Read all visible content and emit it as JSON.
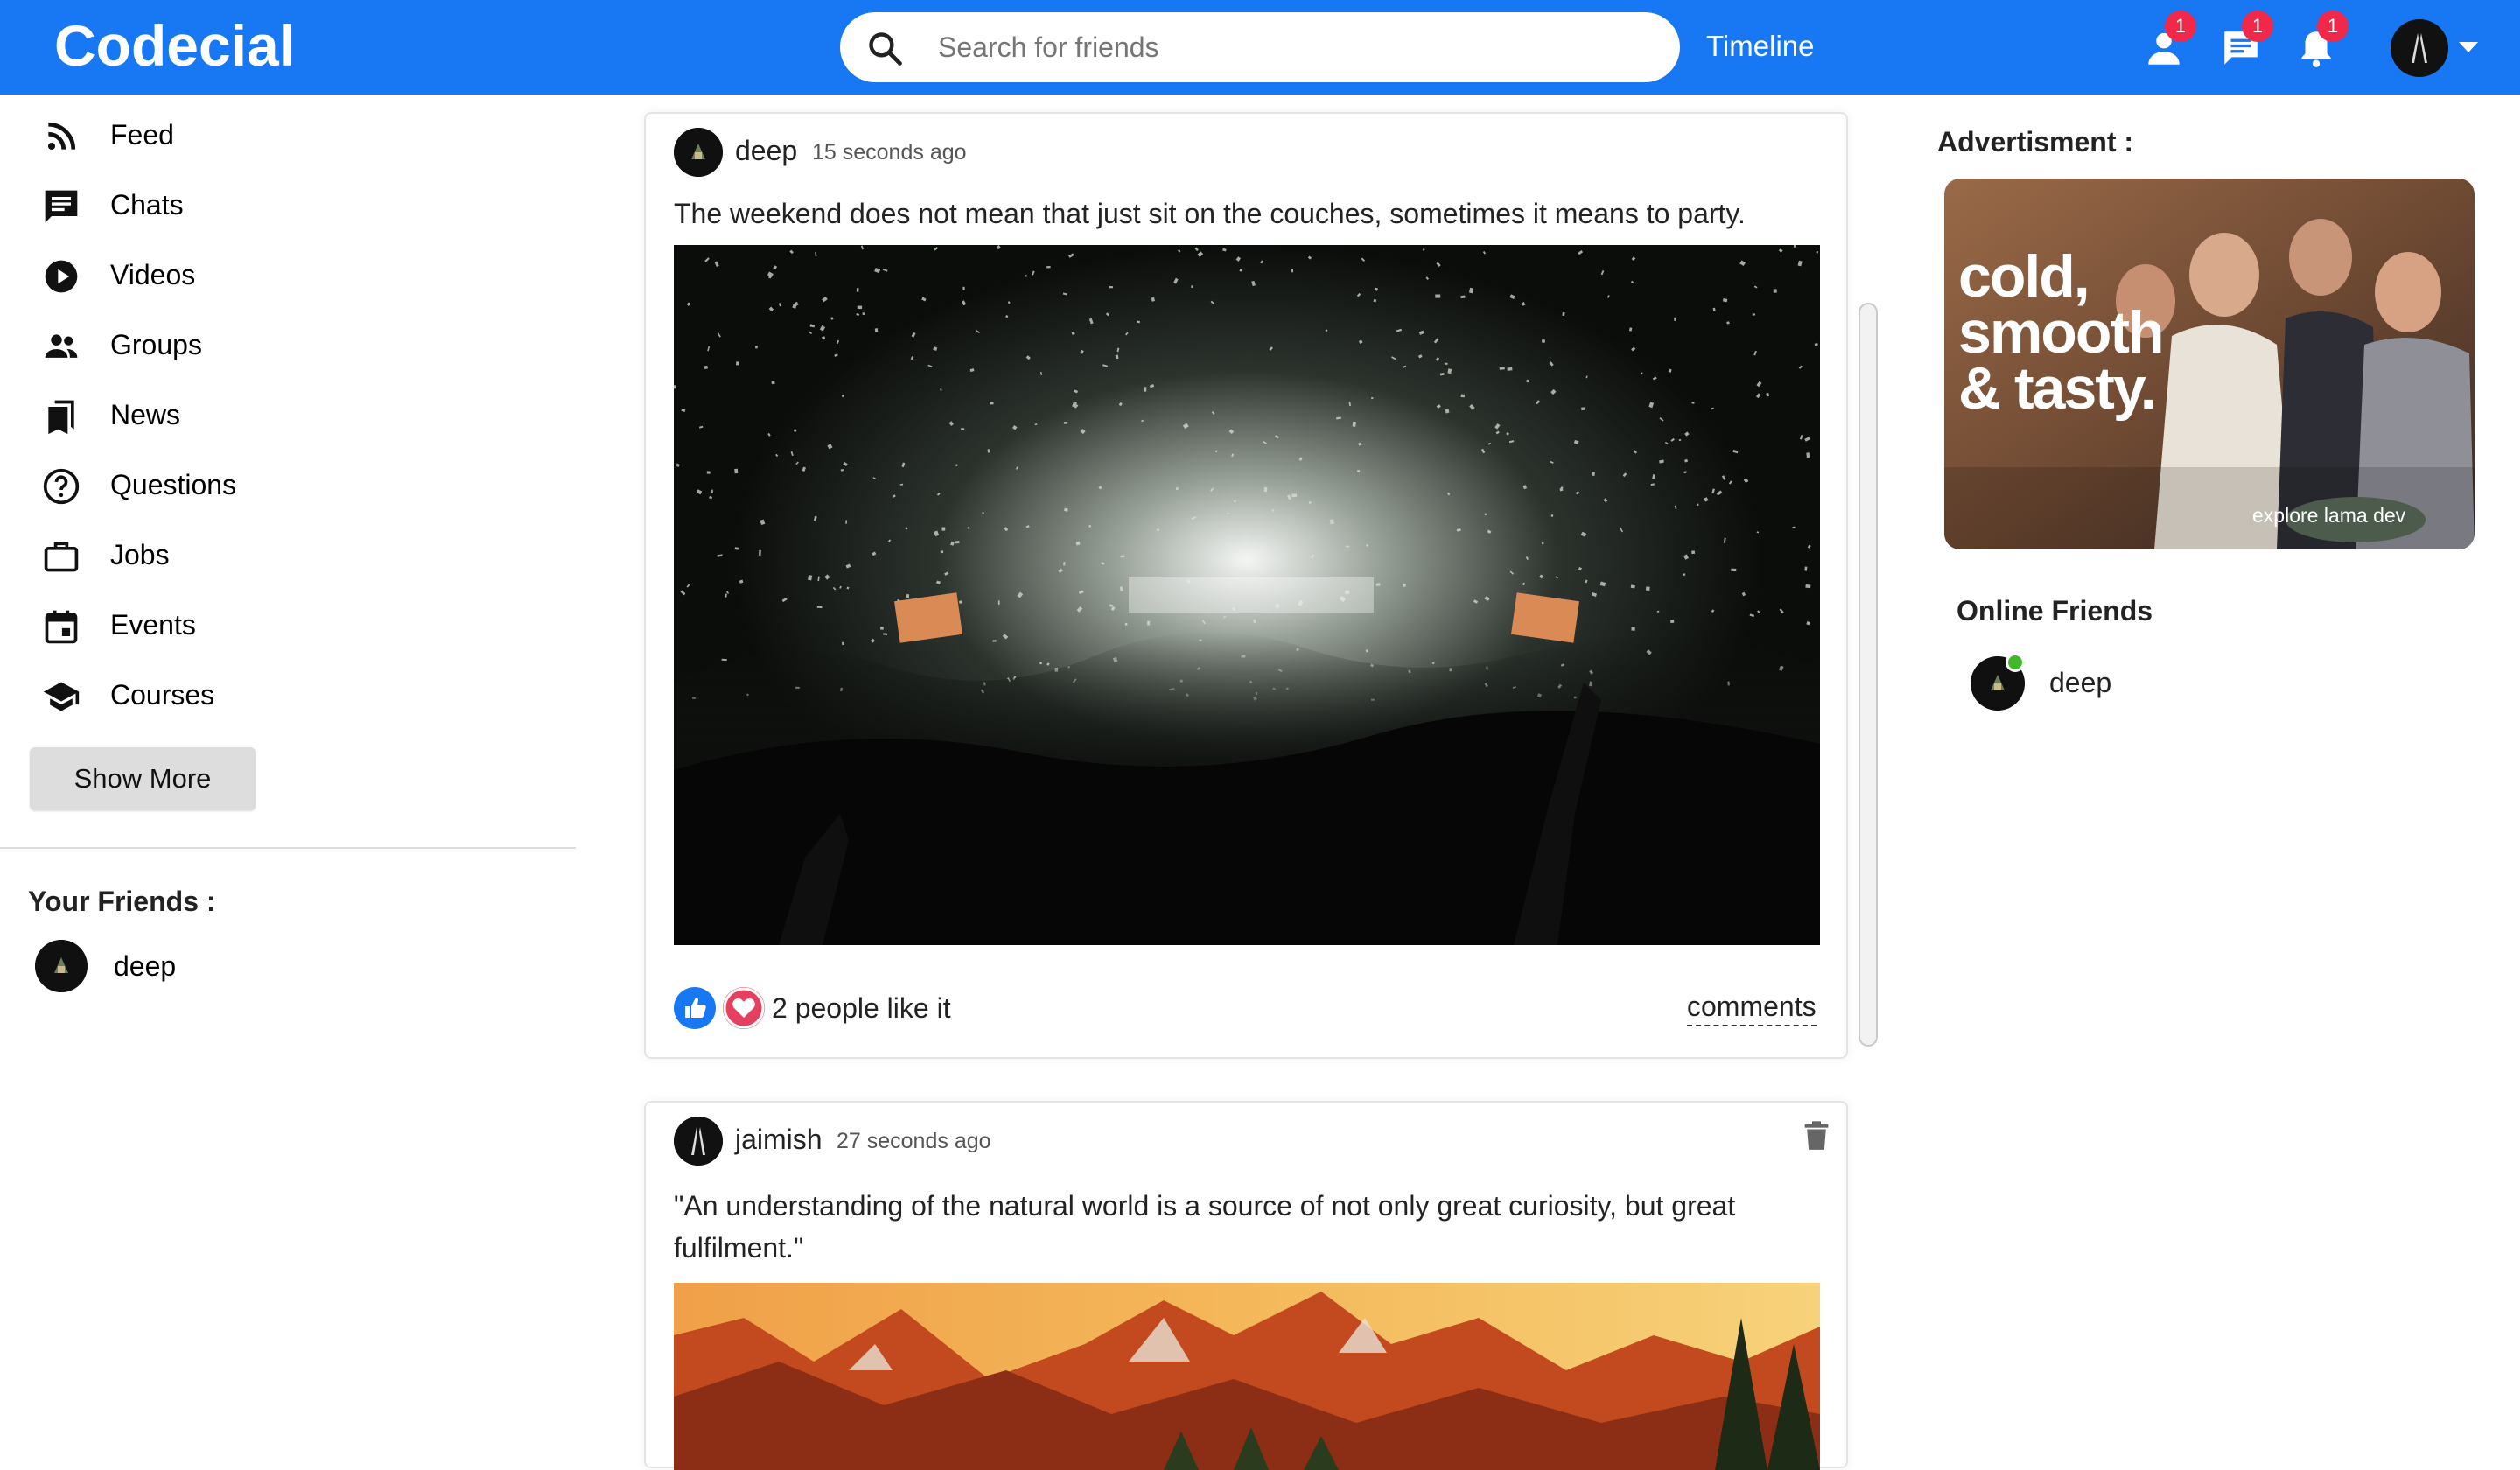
{
  "header": {
    "logo": "Codecial",
    "search_placeholder": "Search for friends",
    "timeline_label": "Timeline",
    "badges": {
      "friend_requests": "1",
      "messages": "1",
      "notifications": "1"
    },
    "brand_color": "#1877f2",
    "badge_color": "#f02849"
  },
  "sidebar": {
    "items": [
      {
        "label": "Feed",
        "icon": "rss-feed-icon"
      },
      {
        "label": "Chats",
        "icon": "chat-icon"
      },
      {
        "label": "Videos",
        "icon": "play-circle-icon"
      },
      {
        "label": "Groups",
        "icon": "group-icon"
      },
      {
        "label": "News",
        "icon": "bookmarks-icon"
      },
      {
        "label": "Questions",
        "icon": "help-outline-icon"
      },
      {
        "label": "Jobs",
        "icon": "work-outline-icon"
      },
      {
        "label": "Events",
        "icon": "event-icon"
      },
      {
        "label": "Courses",
        "icon": "school-icon"
      }
    ],
    "show_more": "Show More",
    "friends_title": "Your Friends :",
    "friends": [
      {
        "name": "deep"
      }
    ]
  },
  "feed": {
    "posts": [
      {
        "user": "deep",
        "time": "15 seconds ago",
        "text": "The weekend does not mean that just sit on the couches, sometimes it means to party.",
        "image": "concert-crowd-confetti-photo",
        "likes": "2 people like it",
        "comments_label": "comments"
      },
      {
        "user": "jaimish",
        "time": "27 seconds ago",
        "text": "\"An understanding of the natural world is a source of not only great curiosity, but great fulfilment.\"",
        "image": "mountain-sunset-photo",
        "deletable": true
      }
    ]
  },
  "rightbar": {
    "ad_title": "Advertisment :",
    "ad_lines": [
      "cold,",
      "smooth",
      "& tasty."
    ],
    "ad_small": "explore lama dev",
    "online_title": "Online Friends",
    "online_friends": [
      {
        "name": "deep"
      }
    ],
    "online_color": "#42b72a"
  }
}
